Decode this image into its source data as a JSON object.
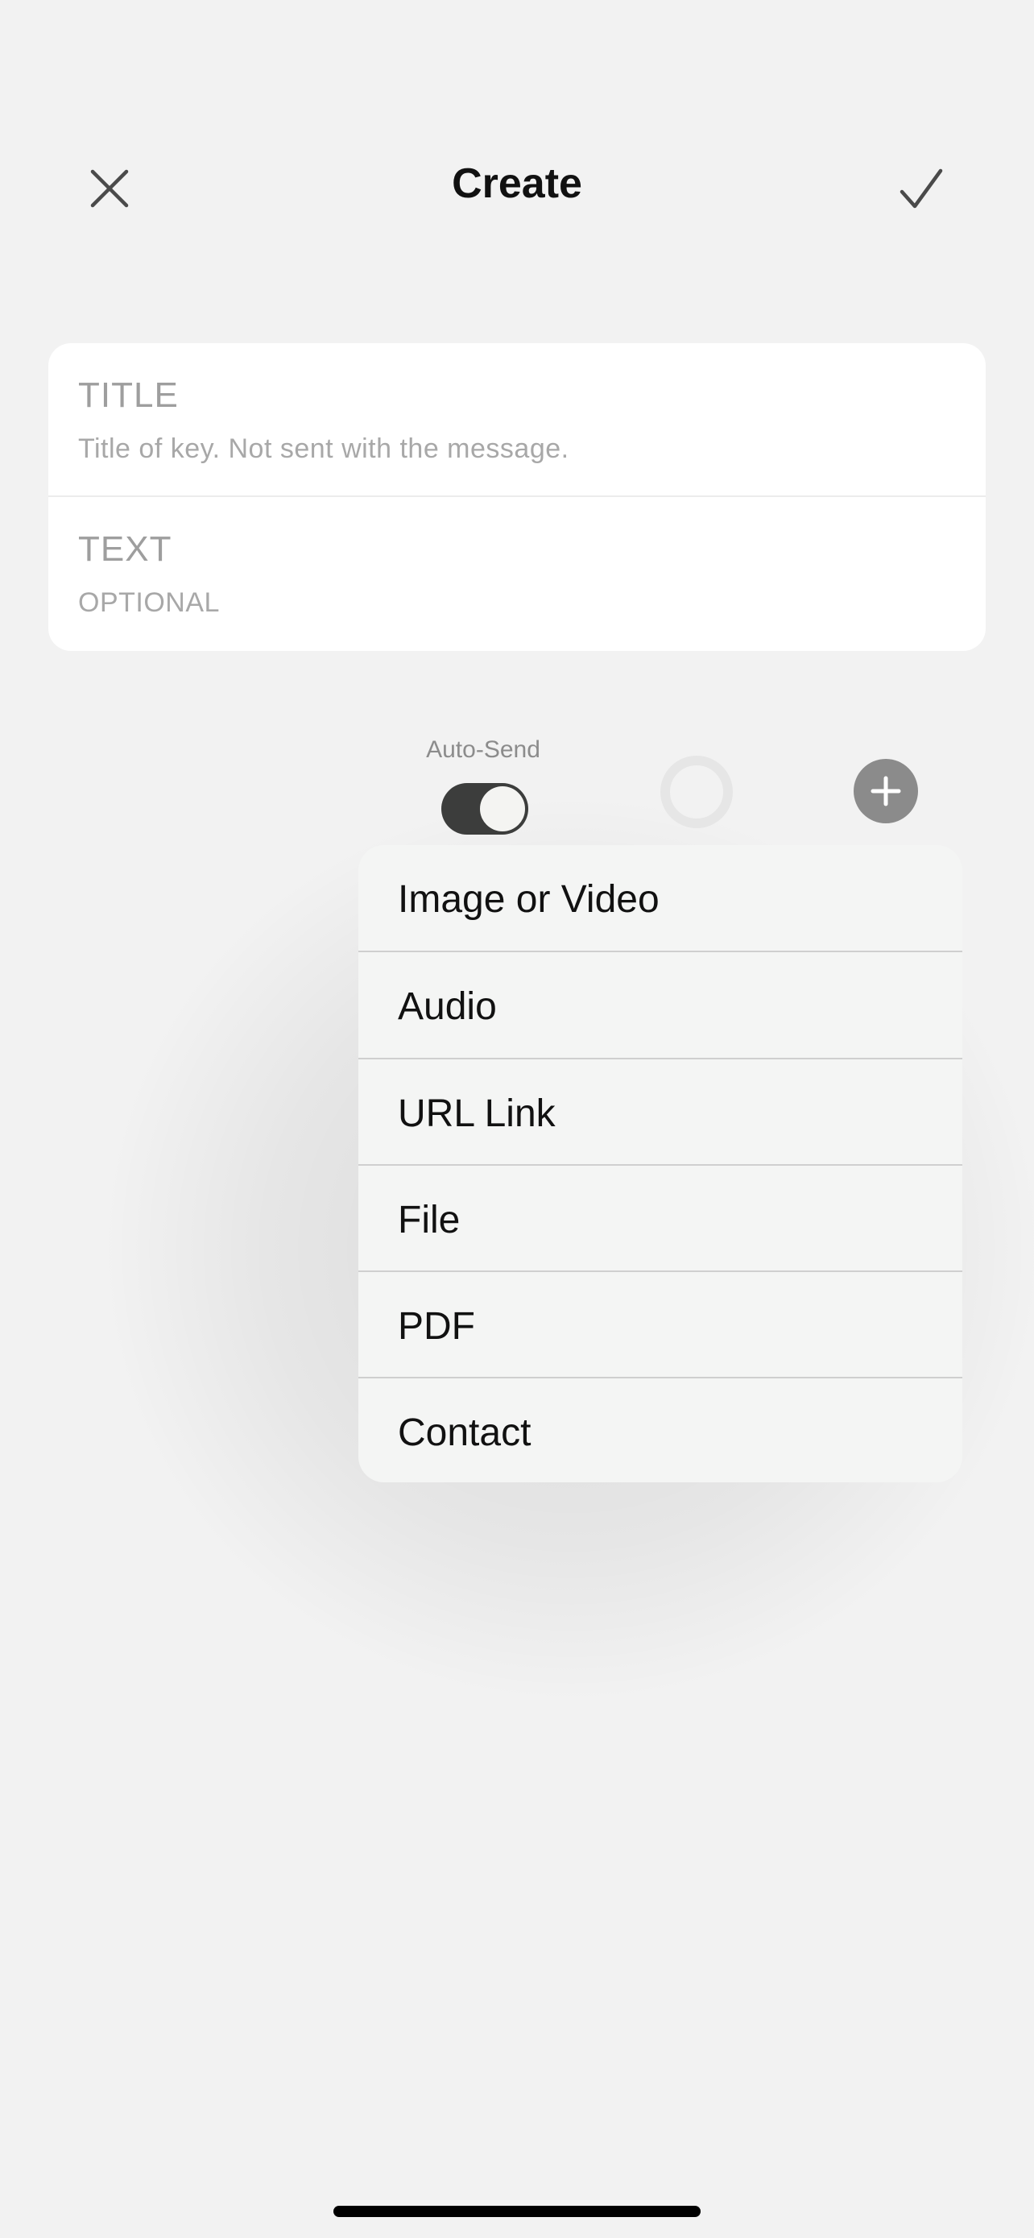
{
  "header": {
    "title": "Create",
    "close_icon": "close-icon",
    "confirm_icon": "checkmark-icon"
  },
  "form": {
    "title_field": {
      "label": "TITLE",
      "hint": "Title of key. Not sent with the message."
    },
    "text_field": {
      "label": "TEXT",
      "hint": "OPTIONAL"
    }
  },
  "controls": {
    "auto_send_label": "Auto-Send",
    "auto_send_on": true,
    "ring_icon": "record-ring-icon",
    "add_icon": "plus-icon"
  },
  "attach_menu": {
    "items": [
      {
        "label": "Image or Video"
      },
      {
        "label": "Audio"
      },
      {
        "label": "URL Link"
      },
      {
        "label": "File"
      },
      {
        "label": "PDF"
      },
      {
        "label": "Contact"
      }
    ]
  },
  "colors": {
    "background": "#f2f2f2",
    "toggle_on": "#3c3d3c",
    "add_button": "#8b8b8b"
  }
}
